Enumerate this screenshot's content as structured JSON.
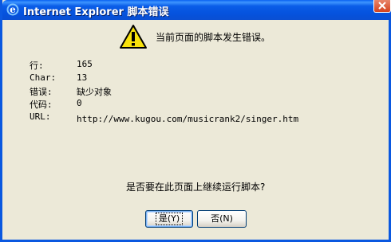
{
  "titlebar": {
    "title": "Internet Explorer 脚本错误",
    "icon": "ie-icon"
  },
  "dialog": {
    "headline": "当前页面的脚本发生错误。",
    "icon": "warning-icon",
    "details": [
      {
        "label": "行:",
        "value": "165"
      },
      {
        "label": "Char:",
        "value": "13"
      },
      {
        "label": "错误:",
        "value": "缺少对象"
      },
      {
        "label": "代码:",
        "value": "0"
      },
      {
        "label": "URL:",
        "value": "http://www.kugou.com/musicrank2/singer.htm"
      }
    ],
    "prompt": "是否要在此页面上继续运行脚本?",
    "buttons": {
      "yes": "是(Y)",
      "no": "否(N)"
    }
  },
  "colors": {
    "titlebar": "#0552dd",
    "dialog_bg": "#ece9d8",
    "close_button": "#d4431e"
  }
}
